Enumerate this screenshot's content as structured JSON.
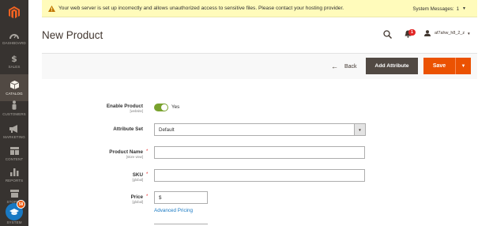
{
  "sidebar": {
    "logo_icon": "magento-logo-icon",
    "items": [
      {
        "label": "DASHBOARD",
        "icon": "dashboard-icon"
      },
      {
        "label": "SALES",
        "icon": "dollar-icon"
      },
      {
        "label": "CATALOG",
        "icon": "catalog-box-icon",
        "active": true
      },
      {
        "label": "CUSTOMERS",
        "icon": "customer-person-icon"
      },
      {
        "label": "MARKETING",
        "icon": "megaphone-icon"
      },
      {
        "label": "CONTENT",
        "icon": "content-layout-icon"
      },
      {
        "label": "REPORTS",
        "icon": "bar-chart-icon"
      },
      {
        "label": "STORES",
        "icon": "store-icon"
      },
      {
        "label": "SYSTEM",
        "icon": "gear-icon"
      }
    ],
    "help_badge": "58",
    "help_icon": "graduation-cap-icon"
  },
  "message_bar": {
    "text": "Your web server is set up incorrectly and allows unauthorized access to sensitive files. Please contact your hosting provider.",
    "system_messages_label": "System Messages:",
    "system_messages_count": "1",
    "icon": "warning-icon"
  },
  "header": {
    "title": "New Product",
    "notification_count": "1",
    "user_name": "af7ahw_h8_2_z"
  },
  "actions": {
    "back_label": "Back",
    "add_attribute_label": "Add Attribute",
    "save_label": "Save"
  },
  "form": {
    "enable_product": {
      "label": "Enable Product",
      "scope": "[website]",
      "value": "Yes"
    },
    "attribute_set": {
      "label": "Attribute Set",
      "value": "Default"
    },
    "product_name": {
      "label": "Product Name",
      "scope": "[store view]",
      "value": ""
    },
    "sku": {
      "label": "SKU",
      "scope": "[global]",
      "value": ""
    },
    "price": {
      "label": "Price",
      "scope": "[global]",
      "currency_symbol": "$",
      "value": ""
    },
    "advanced_pricing_link": "Advanced Pricing"
  },
  "colors": {
    "sidebar_bg": "#373330",
    "sidebar_active": "#514943",
    "accent_orange": "#eb5202",
    "toggle_green": "#79a22e",
    "link_blue": "#1979c3",
    "message_bg": "#fffbbb"
  }
}
